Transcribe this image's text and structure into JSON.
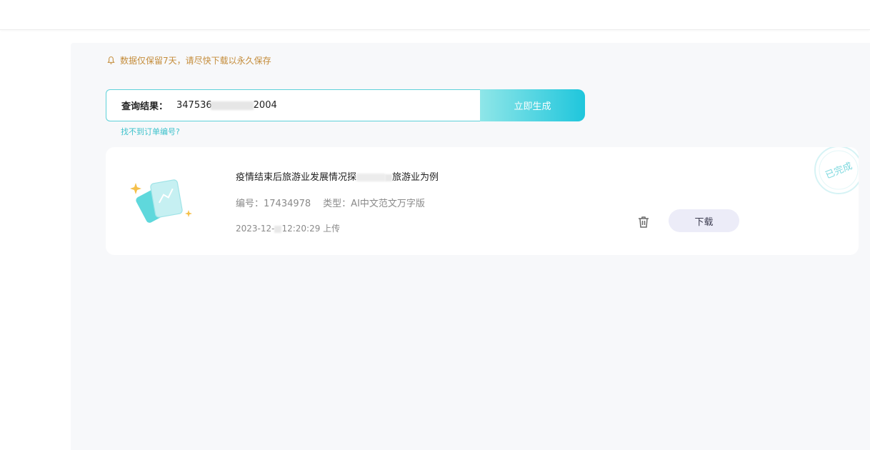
{
  "notice": {
    "text": "数据仅保留7天，请尽快下载以永久保存",
    "icon": "bell-icon",
    "color": "#c48c3a"
  },
  "search": {
    "label": "查询结果：",
    "value_prefix": "347536",
    "value_suffix": "2004",
    "button_label": "立即生成"
  },
  "find_link": "找不到订单编号?",
  "record": {
    "title_prefix": "疫情结束后旅游业发展情况探",
    "title_suffix": "旅游业为例",
    "meta_id": "编号：17434978",
    "meta_type": "类型：AI中文范文万字版",
    "time_prefix": "2023-12-",
    "time_suffix": "12:20:29 上传",
    "download_label": "下载",
    "status_stamp": "已完成"
  },
  "colors": {
    "accent": "#1fc6dc",
    "accent_light": "#8fe6e8",
    "panel_bg": "#f7f8fa",
    "download_bg": "#ececf8"
  }
}
